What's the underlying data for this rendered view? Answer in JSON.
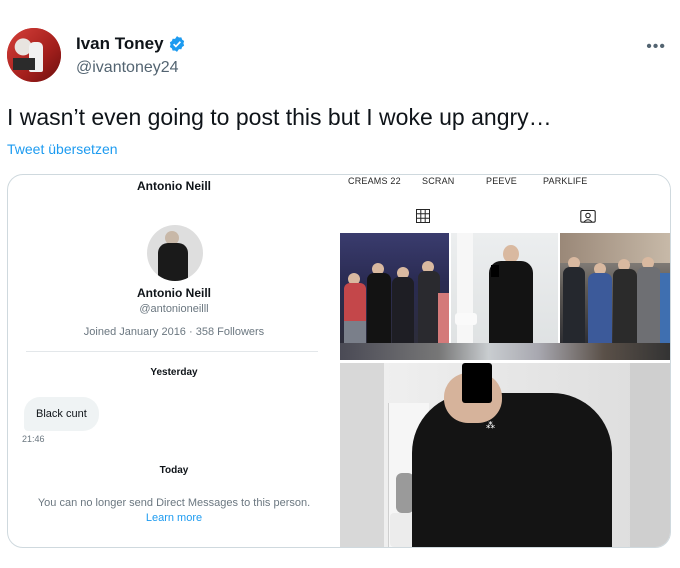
{
  "tweet": {
    "author_name": "Ivan Toney",
    "author_handle": "@ivantoney24",
    "verified": true,
    "more_icon": "more-icon",
    "text": "I wasn’t even going to post this but I woke up angry…",
    "translate_label": "Tweet übersetzen"
  },
  "dm": {
    "header_name": "Antonio Neill",
    "profile_name": "Antonio Neill",
    "profile_handle": "@antonioneilll",
    "joined": "Joined January 2016 · 358 Followers",
    "yesterday_label": "Yesterday",
    "message_text": "Black cunt",
    "message_time": "21:46",
    "today_label": "Today",
    "notice": "You can no longer send Direct Messages to this person.",
    "learn_more": "Learn more"
  },
  "instagram": {
    "tabs": [
      "CREAMS 22",
      "SCRAN",
      "PEEVE",
      "PARKLIFE"
    ],
    "grid_icon": "grid-icon",
    "tagged_icon": "tagged-icon"
  },
  "colors": {
    "link": "#1d9bf0",
    "verified": "#1d9bf0",
    "secondary_text": "#536471"
  }
}
